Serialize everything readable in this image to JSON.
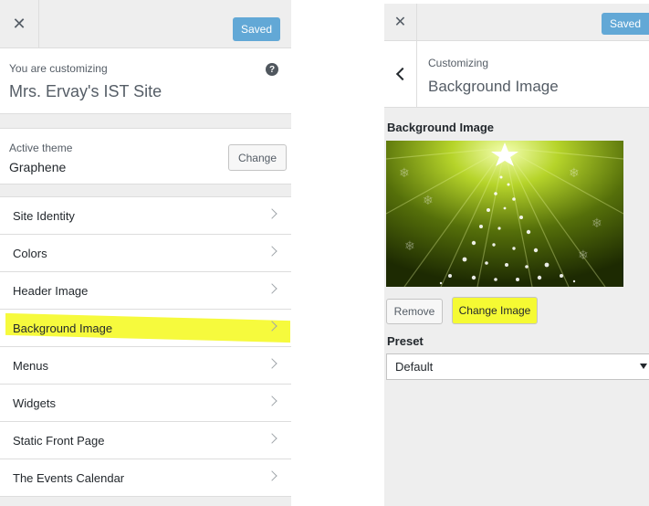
{
  "left_panel": {
    "close_icon": "close-icon",
    "saved_label": "Saved",
    "customizing_label": "You are customizing",
    "site_title": "Mrs. Ervay's IST Site",
    "help_icon": "help-icon",
    "theme_label": "Active theme",
    "theme_name": "Graphene",
    "change_label": "Change",
    "nav": [
      {
        "label": "Site Identity",
        "highlighted": false
      },
      {
        "label": "Colors",
        "highlighted": false
      },
      {
        "label": "Header Image",
        "highlighted": false
      },
      {
        "label": "Background Image",
        "highlighted": true
      },
      {
        "label": "Menus",
        "highlighted": false
      },
      {
        "label": "Widgets",
        "highlighted": false
      },
      {
        "label": "Static Front Page",
        "highlighted": false
      },
      {
        "label": "The Events Calendar",
        "highlighted": false
      }
    ]
  },
  "right_panel": {
    "close_icon": "close-icon",
    "saved_label": "Saved",
    "back_icon": "chevron-left-icon",
    "section_small": "Customizing",
    "section_title": "Background Image",
    "field_title": "Background Image",
    "remove_label": "Remove",
    "change_image_label": "Change Image",
    "preset_label": "Preset",
    "preset_value": "Default"
  },
  "colors": {
    "accent_blue": "#62a8d6",
    "highlight_yellow": "#f5fa33",
    "panel_bg": "#eeeeee"
  }
}
